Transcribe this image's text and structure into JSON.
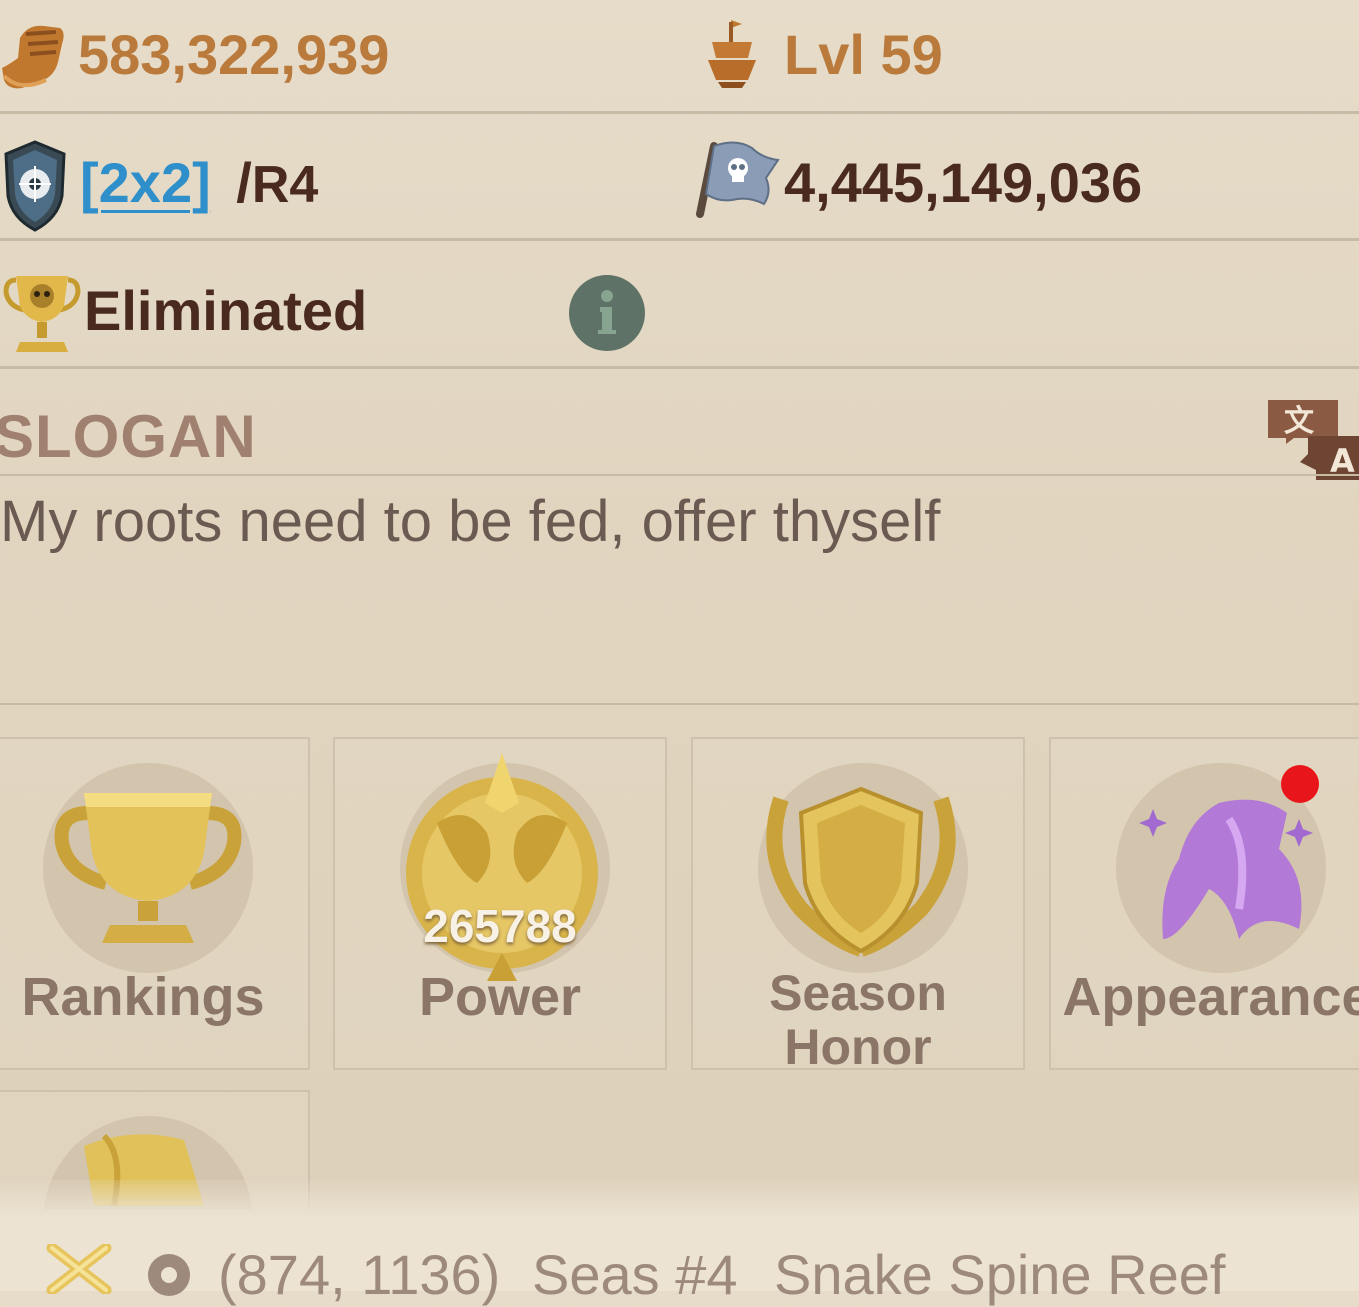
{
  "stats": {
    "power_value": "583,322,939",
    "ship_level": "Lvl 59",
    "alliance_tag": "[2x2]",
    "alliance_separator": "/",
    "alliance_rank": "R4",
    "kills_value": "4,445,149,036",
    "status": "Eliminated"
  },
  "slogan": {
    "title": "SLOGAN",
    "text": "My roots need to be fed, offer thyself",
    "translate_glyph_zh": "文",
    "translate_glyph_en": "A"
  },
  "tiles": [
    {
      "label": "Rankings"
    },
    {
      "label": "Power",
      "badge": "265788"
    },
    {
      "label_line1": "Season",
      "label_line2": "Honor"
    },
    {
      "label": "Appearance"
    }
  ],
  "location": {
    "coords": "(874, 1136)",
    "sea": "Seas #4",
    "place": "Snake Spine Reef"
  },
  "colors": {
    "gold_text": "#b97a3c",
    "dark_text": "#4a2a1e",
    "link_blue": "#2f8fca",
    "notification_red": "#e8161b"
  }
}
